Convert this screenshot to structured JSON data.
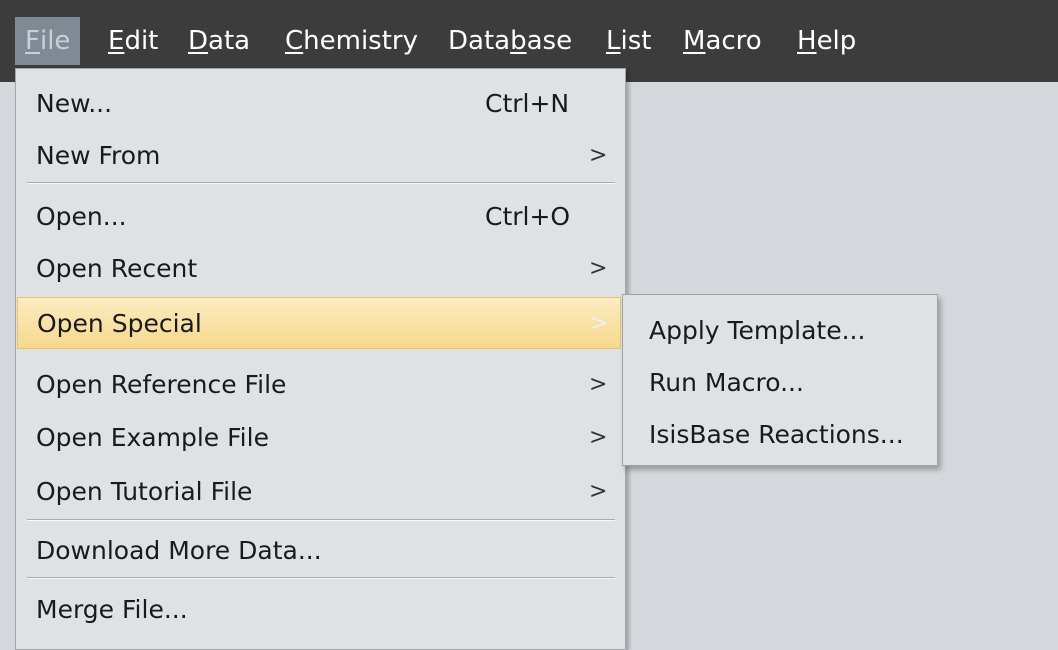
{
  "menubar": {
    "items": [
      {
        "name": "File",
        "ul": "F",
        "rest": "ile"
      },
      {
        "name": "Edit",
        "ul": "E",
        "rest": "dit"
      },
      {
        "name": "Data",
        "ul": "D",
        "rest": "ata"
      },
      {
        "name": "Chemistry",
        "ul": "C",
        "rest": "hemistry"
      },
      {
        "name": "Database",
        "pre": "Data",
        "ul": "b",
        "rest": "ase"
      },
      {
        "name": "List",
        "ul": "L",
        "rest": "ist"
      },
      {
        "name": "Macro",
        "ul": "M",
        "rest": "acro"
      },
      {
        "name": "Help",
        "ul": "H",
        "rest": "elp"
      }
    ]
  },
  "file_menu": {
    "new": {
      "label": "New...",
      "shortcut": "Ctrl+N"
    },
    "new_from": {
      "label": "New From",
      "arrow": ">"
    },
    "open": {
      "label": "Open...",
      "shortcut": "Ctrl+O"
    },
    "open_recent": {
      "label": "Open Recent",
      "arrow": ">"
    },
    "open_special": {
      "label": "Open Special",
      "arrow": ">"
    },
    "open_reference": {
      "label": "Open Reference File",
      "arrow": ">"
    },
    "open_example": {
      "label": "Open Example File",
      "arrow": ">"
    },
    "open_tutorial": {
      "label": "Open Tutorial File",
      "arrow": ">"
    },
    "download_more": {
      "label": "Download More Data..."
    },
    "merge_file": {
      "label": "Merge File..."
    }
  },
  "open_special_submenu": {
    "items": [
      "Apply Template...",
      "Run Macro...",
      "IsisBase Reactions..."
    ]
  },
  "colors": {
    "menubar_bg": "#3c3c3c",
    "menu_bg": "#dfe2e5",
    "highlight": "#f7d88e",
    "workspace_bg": "#d4d8dc"
  }
}
